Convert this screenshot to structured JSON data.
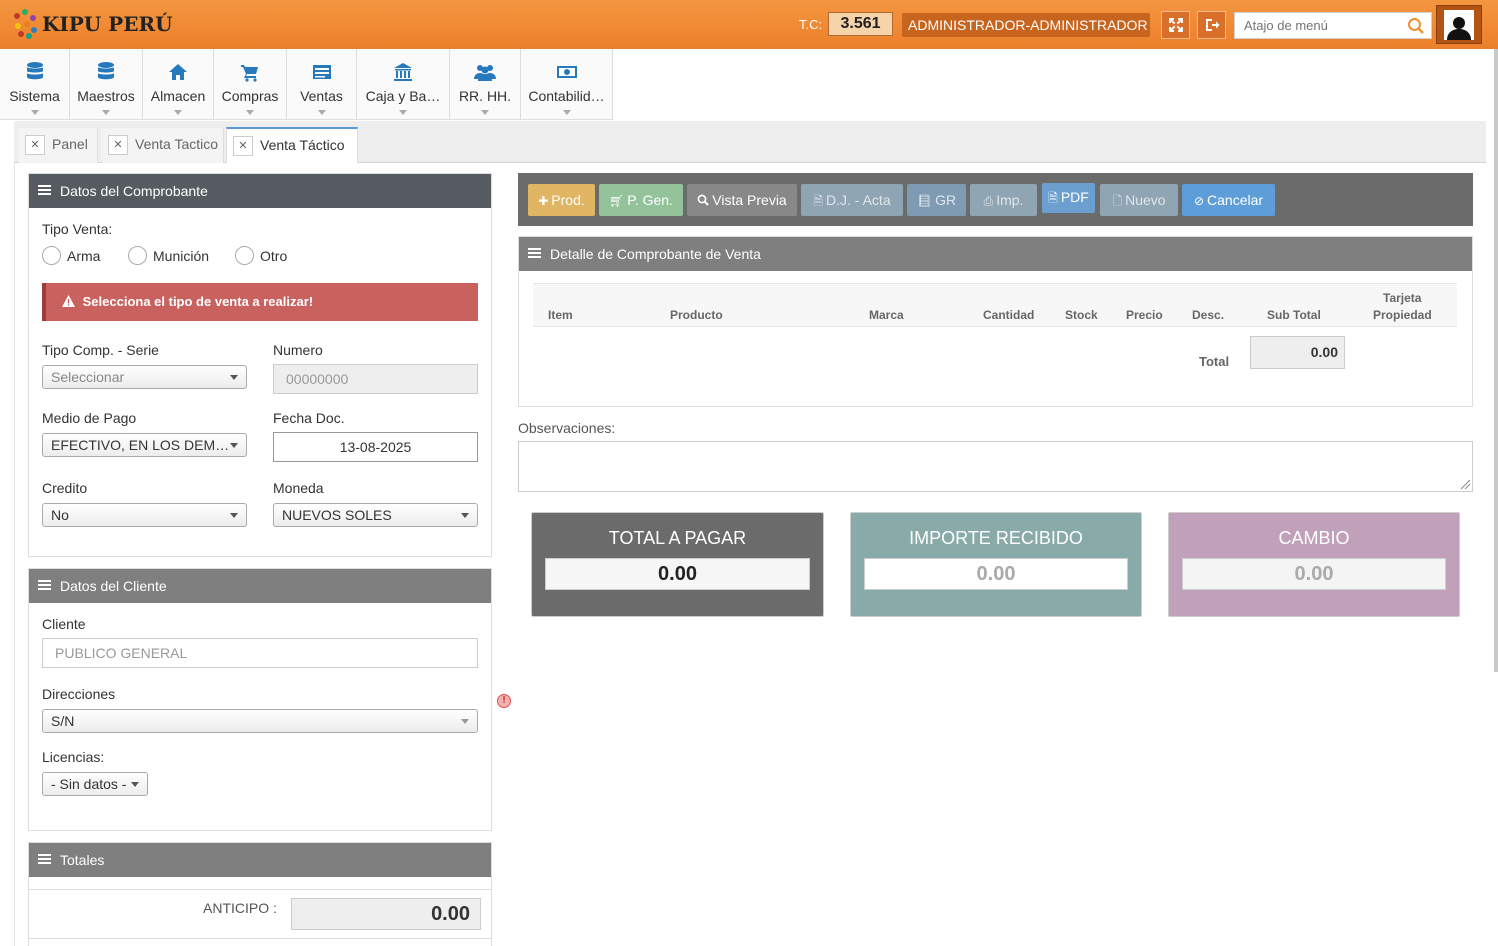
{
  "header": {
    "logo_text": "KIPU PERÚ",
    "tc_label": "T.C:",
    "tc_value": "3.561",
    "user": "ADMINISTRADOR-ADMINISTRADOR",
    "search_placeholder": "Atajo de menú"
  },
  "menu": {
    "items": [
      {
        "label": "Sistema",
        "icon": "database-icon"
      },
      {
        "label": "Maestros",
        "icon": "database-icon"
      },
      {
        "label": "Almacen",
        "icon": "home-icon"
      },
      {
        "label": "Compras",
        "icon": "cart-icon"
      },
      {
        "label": "Ventas",
        "icon": "list-icon"
      },
      {
        "label": "Caja y Ba…",
        "icon": "bank-icon"
      },
      {
        "label": "RR. HH.",
        "icon": "users-icon"
      },
      {
        "label": "Contabilid…",
        "icon": "money-icon"
      }
    ]
  },
  "tabs": [
    {
      "label": "Panel"
    },
    {
      "label": "Venta Tactico"
    },
    {
      "label": "Venta Táctico"
    }
  ],
  "comprobante": {
    "title": "Datos del Comprobante",
    "tipo_venta_label": "Tipo Venta:",
    "radios": [
      "Arma",
      "Munición",
      "Otro"
    ],
    "alert": "Selecciona el tipo de venta a realizar!",
    "tipo_comp_label": "Tipo Comp. - Serie",
    "tipo_comp_value": "Seleccionar",
    "numero_label": "Numero",
    "numero_value": "00000000",
    "medio_pago_label": "Medio de Pago",
    "medio_pago_value": "EFECTIVO, EN LOS DEM…",
    "fecha_label": "Fecha Doc.",
    "fecha_value": "13-08-2025",
    "credito_label": "Credito",
    "credito_value": "No",
    "moneda_label": "Moneda",
    "moneda_value": "NUEVOS SOLES"
  },
  "cliente": {
    "title": "Datos del Cliente",
    "cliente_label": "Cliente",
    "cliente_placeholder": "PUBLICO GENERAL",
    "direcciones_label": "Direcciones",
    "direcciones_value": "S/N",
    "licencias_label": "Licencias:",
    "licencias_value": "- Sin datos -"
  },
  "totales": {
    "title": "Totales",
    "anticipo_label": "ANTICIPO :",
    "anticipo_value": "0.00"
  },
  "toolbar": {
    "prod": "Prod.",
    "pgen": "P. Gen.",
    "vista": "Vista Previa",
    "dj": "D.J. - Acta",
    "gr": "GR",
    "imp": "Imp.",
    "pdf": "PDF",
    "nuevo": "Nuevo",
    "cancelar": "Cancelar"
  },
  "detalle": {
    "title": "Detalle de Comprobante de Venta",
    "columns": [
      "Item",
      "Producto",
      "Marca",
      "Cantidad",
      "Stock",
      "Precio",
      "Desc.",
      "Sub Total",
      "Tarjeta",
      "Propiedad"
    ],
    "total_label": "Total",
    "total_value": "0.00"
  },
  "observaciones_label": "Observaciones:",
  "summary": {
    "total_pagar_label": "TOTAL A PAGAR",
    "total_pagar_value": "0.00",
    "importe_label": "IMPORTE RECIBIDO",
    "importe_value": "0.00",
    "cambio_label": "CAMBIO",
    "cambio_value": "0.00"
  },
  "colors": {
    "header": "#ec7f2a",
    "alert": "#c9625f",
    "total_box": "#6b6b6b",
    "importe_box": "#88aaa8",
    "cambio_box": "#c1a1ba"
  }
}
